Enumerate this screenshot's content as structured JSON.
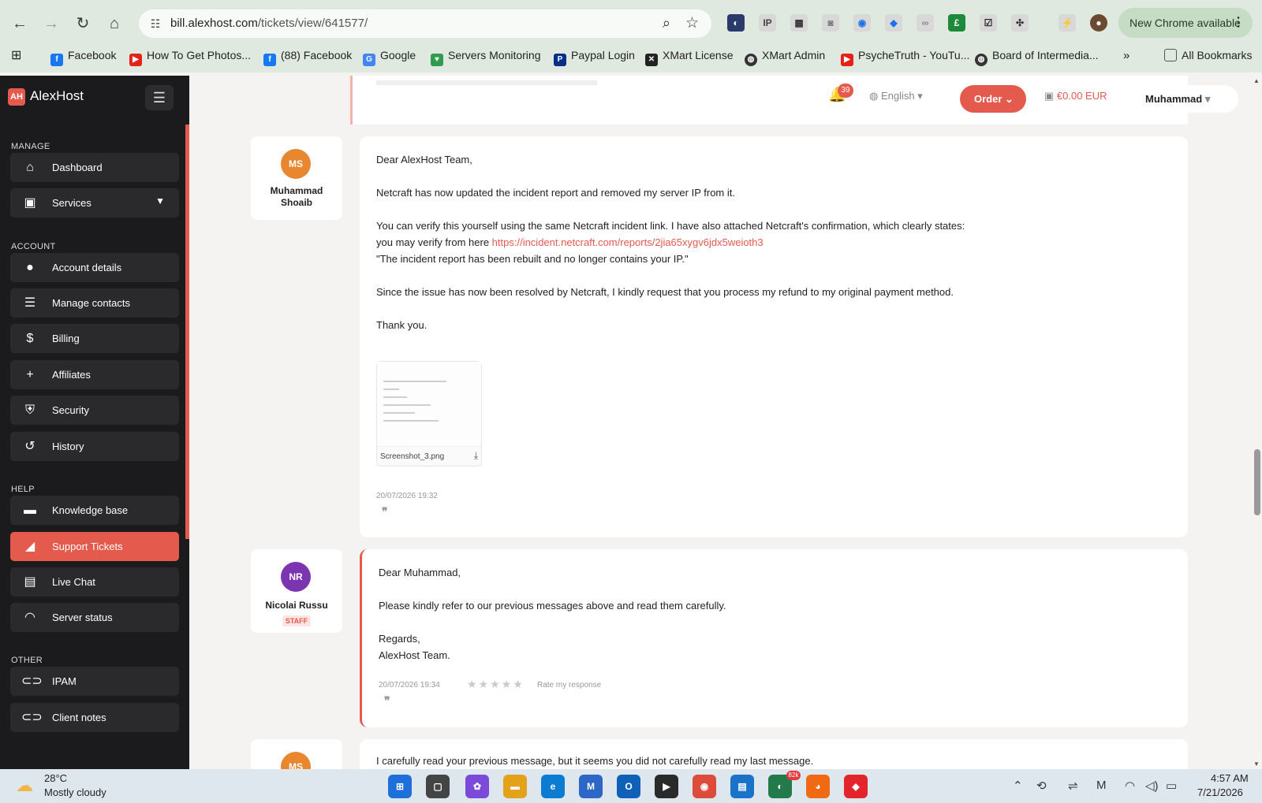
{
  "browser": {
    "url_host": "bill.alexhost.com",
    "url_path": "/tickets/view/641577/",
    "new_chrome_label": "New Chrome available",
    "bookmarks": [
      {
        "label": "Facebook",
        "icon": "facebook-icon",
        "color": "#1877f2"
      },
      {
        "label": "How To Get Photos...",
        "icon": "youtube-icon",
        "color": "#e62117"
      },
      {
        "label": "(88) Facebook",
        "icon": "facebook-icon",
        "color": "#1877f2"
      },
      {
        "label": "Google",
        "icon": "google-icon",
        "color": "#4285f4"
      },
      {
        "label": "Servers Monitoring",
        "icon": "monitor-icon",
        "color": "#2e9b4f"
      },
      {
        "label": "Paypal Login",
        "icon": "paypal-icon",
        "color": "#003087"
      },
      {
        "label": "XMart License",
        "icon": "xmart-icon",
        "color": "#222222"
      },
      {
        "label": "XMart Admin",
        "icon": "globe-icon",
        "color": "#333333"
      },
      {
        "label": "PsycheTruth - YouTu...",
        "icon": "youtube-icon",
        "color": "#e62117"
      },
      {
        "label": "Board of Intermedia...",
        "icon": "globe-icon",
        "color": "#333333"
      }
    ],
    "all_bookmarks_label": "All Bookmarks"
  },
  "sidebar": {
    "brand": "AlexHost",
    "sections": {
      "manage": "MANAGE",
      "account": "ACCOUNT",
      "help": "HELP",
      "other": "OTHER"
    },
    "items": {
      "dashboard": "Dashboard",
      "services": "Services",
      "account_details": "Account details",
      "manage_contacts": "Manage contacts",
      "billing": "Billing",
      "affiliates": "Affiliates",
      "security": "Security",
      "history": "History",
      "knowledge_base": "Knowledge base",
      "support_tickets": "Support Tickets",
      "live_chat": "Live Chat",
      "server_status": "Server status",
      "ipam": "IPAM",
      "client_notes": "Client notes"
    }
  },
  "header": {
    "notification_count": "39",
    "language": "English",
    "order_label": "Order",
    "balance": "€0.00 EUR",
    "user_name": "Muhammad"
  },
  "messages": [
    {
      "initials": "MS",
      "author_line1": "Muhammad",
      "author_line2": "Shoaib",
      "avatar_color": "#e8872f",
      "lines": {
        "l1": "Dear AlexHost Team,",
        "l2": "Netcraft has now updated the incident report and removed my server IP from it.",
        "l3": "You can verify this yourself using the same Netcraft incident link. I have also attached Netcraft's confirmation, which clearly states:",
        "l4_prefix": "you may verify from here",
        "l4_link": "https://incident.netcraft.com/reports/2jia65xygv6jdx5weioth3",
        "l5": "\"The incident report has been rebuilt and no longer contains your IP.\"",
        "l6": "Since the issue has now been resolved by Netcraft, I kindly request that you process my refund to my original payment method.",
        "l7": "Thank you."
      },
      "attachment": "Screenshot_3.png",
      "date": "20/07/2026 19:32"
    },
    {
      "initials": "NR",
      "author": "Nicolai Russu",
      "badge": "STAFF",
      "avatar_color": "#7c35b0",
      "lines": {
        "l1": "Dear Muhammad,",
        "l2": "Please kindly refer to our previous messages above and read them carefully.",
        "l3": "Regards,",
        "l4": "AlexHost Team."
      },
      "date": "20/07/2026 19:34",
      "stars": "★★★★★",
      "rate_label": "Rate my response"
    },
    {
      "initials": "MS",
      "avatar_color": "#e8872f",
      "lines": {
        "l1": "I carefully read your previous message, but it seems you did not carefully read my last message."
      }
    }
  ],
  "taskbar": {
    "temperature": "28°C",
    "weather": "Mostly cloudy",
    "badge": "82k",
    "time": "4:57 AM",
    "date": "7/21/2026"
  }
}
